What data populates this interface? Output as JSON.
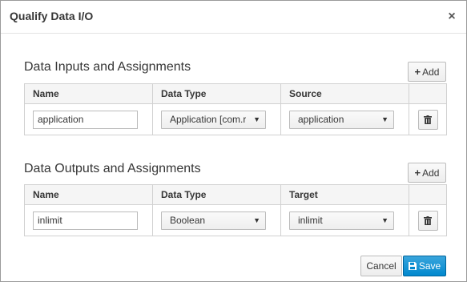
{
  "dialog": {
    "title": "Qualify Data I/O",
    "close_symbol": "×"
  },
  "inputs": {
    "title": "Data Inputs and Assignments",
    "add_label": "Add",
    "columns": [
      "Name",
      "Data Type",
      "Source"
    ],
    "rows": [
      {
        "name": "application",
        "data_type": "Application [com.r",
        "source": "application"
      }
    ]
  },
  "outputs": {
    "title": "Data Outputs and Assignments",
    "add_label": "Add",
    "columns": [
      "Name",
      "Data Type",
      "Target"
    ],
    "rows": [
      {
        "name": "inlimit",
        "data_type": "Boolean",
        "target": "inlimit"
      }
    ]
  },
  "footer": {
    "cancel_label": "Cancel",
    "save_label": "Save"
  },
  "icons": {
    "add": "plus-icon",
    "delete": "trash-icon",
    "save": "floppy-disk-icon",
    "dropdown": "caret-down-icon",
    "close": "close-icon"
  },
  "colors": {
    "primary": "#0088ce",
    "header_bg": "#f5f5f5",
    "border": "#d1d1d1"
  }
}
